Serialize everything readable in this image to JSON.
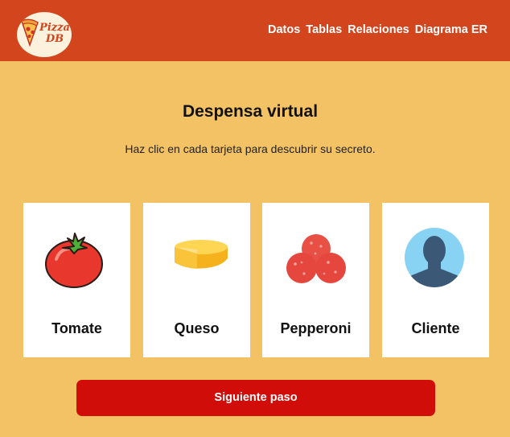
{
  "header": {
    "logo": {
      "line1": "Pizza",
      "line2": "DB",
      "icon": "pizza-slice-icon"
    },
    "nav": [
      "Datos",
      "Tablas",
      "Relaciones",
      "Diagrama ER"
    ]
  },
  "main": {
    "title": "Despensa virtual",
    "subtitle": "Haz clic en cada tarjeta para descubrir su secreto.",
    "cards": [
      {
        "label": "Tomate",
        "icon": "tomato-icon"
      },
      {
        "label": "Queso",
        "icon": "cheese-icon"
      },
      {
        "label": "Pepperoni",
        "icon": "pepperoni-icon"
      },
      {
        "label": "Cliente",
        "icon": "user-avatar-icon"
      }
    ],
    "next_button": "Siguiente paso"
  },
  "colors": {
    "header": "#d2451d",
    "background": "#f3c265",
    "button": "#d10d0a",
    "card": "#ffffff"
  }
}
